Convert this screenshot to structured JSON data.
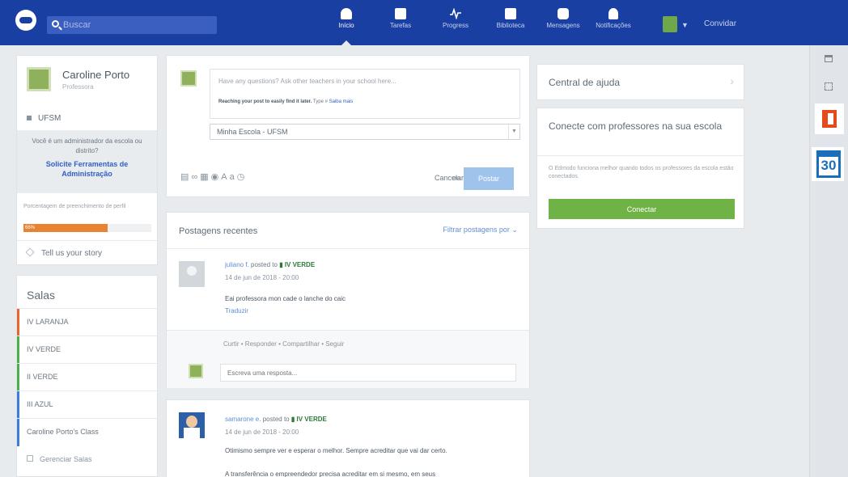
{
  "colors": {
    "topbar": "#1a3fa3",
    "accent_link": "#2f5fc4",
    "progress": "#e88334",
    "connect_button": "#6fb245"
  },
  "search": {
    "placeholder": "Buscar"
  },
  "nav": [
    {
      "label": "Início",
      "icon": "home-icon"
    },
    {
      "label": "Tarefas",
      "icon": "tasks-icon"
    },
    {
      "label": "Progress",
      "icon": "progress-icon"
    },
    {
      "label": "Biblioteca",
      "icon": "library-icon"
    },
    {
      "label": "Mensagens",
      "icon": "messages-icon"
    },
    {
      "label": "Notificações",
      "icon": "notifications-icon"
    }
  ],
  "header": {
    "invite_label": "Convidar"
  },
  "profile": {
    "name": "Caroline Porto",
    "role": "Professora",
    "school": "UFSM",
    "admin_question": "Você é um administrador da escola ou distrito?",
    "admin_link": "Solicite Ferramentas de Administração",
    "completion_label": "Porcentagem de preenchimento de perfil",
    "completion_value": "66%",
    "completion_fraction": 0.66,
    "story": "Tell us your story"
  },
  "rooms": {
    "title": "Salas",
    "items": [
      {
        "label": "IV LARANJA",
        "color": "#e9652b"
      },
      {
        "label": "IV VERDE",
        "color": "#4cae4c"
      },
      {
        "label": "II VERDE",
        "color": "#4cae4c"
      },
      {
        "label": "III AZUL",
        "color": "#3b7dd8"
      },
      {
        "label": "Caroline Porto's Class",
        "color": "#3b7dd8"
      }
    ],
    "manage": "Gerenciar Salas"
  },
  "composer": {
    "placeholder": "Have any questions? Ask other teachers in your school here...",
    "tip_bold": "Reaching your post to easily find it later.",
    "tip_text": "Type #",
    "tip_link": "Saiba mais",
    "recipient": "Minha Escola - UFSM",
    "cancel": "Cancelar",
    "or": "ou",
    "post": "Postar"
  },
  "feed": {
    "title": "Postagens recentes",
    "filter": "Filtrar postagens por",
    "post1": {
      "author": "juliano f.",
      "posted_to": "posted to",
      "group": "IV VERDE",
      "date": "14 de jun de 2018 - 20:00",
      "text": "Eai professora mon cade o lanche do caic",
      "translate": "Traduzir",
      "actions": "Curtir  •  Responder  •  Compartilhar  •  Seguir",
      "reply_placeholder": "Escreva uma resposta..."
    },
    "post2": {
      "author": "samarone e.",
      "posted_to": "posted to",
      "group": "IV VERDE",
      "date": "14 de jun de 2018 - 20:00",
      "text": "Otimismo sempre ver e esperar o melhor. Sempre acreditar que vai dar certo.",
      "text2": "A transferência o empreendedor precisa acreditar em si mesmo, em seus"
    }
  },
  "help": {
    "title": "Central de ajuda"
  },
  "connect": {
    "title": "Conecte com professores na sua escola",
    "desc": "O Edmodo funciona melhor quando todos os professores da escola estão conectados.",
    "button": "Conectar"
  },
  "rail": {
    "calendar_day": "30"
  }
}
